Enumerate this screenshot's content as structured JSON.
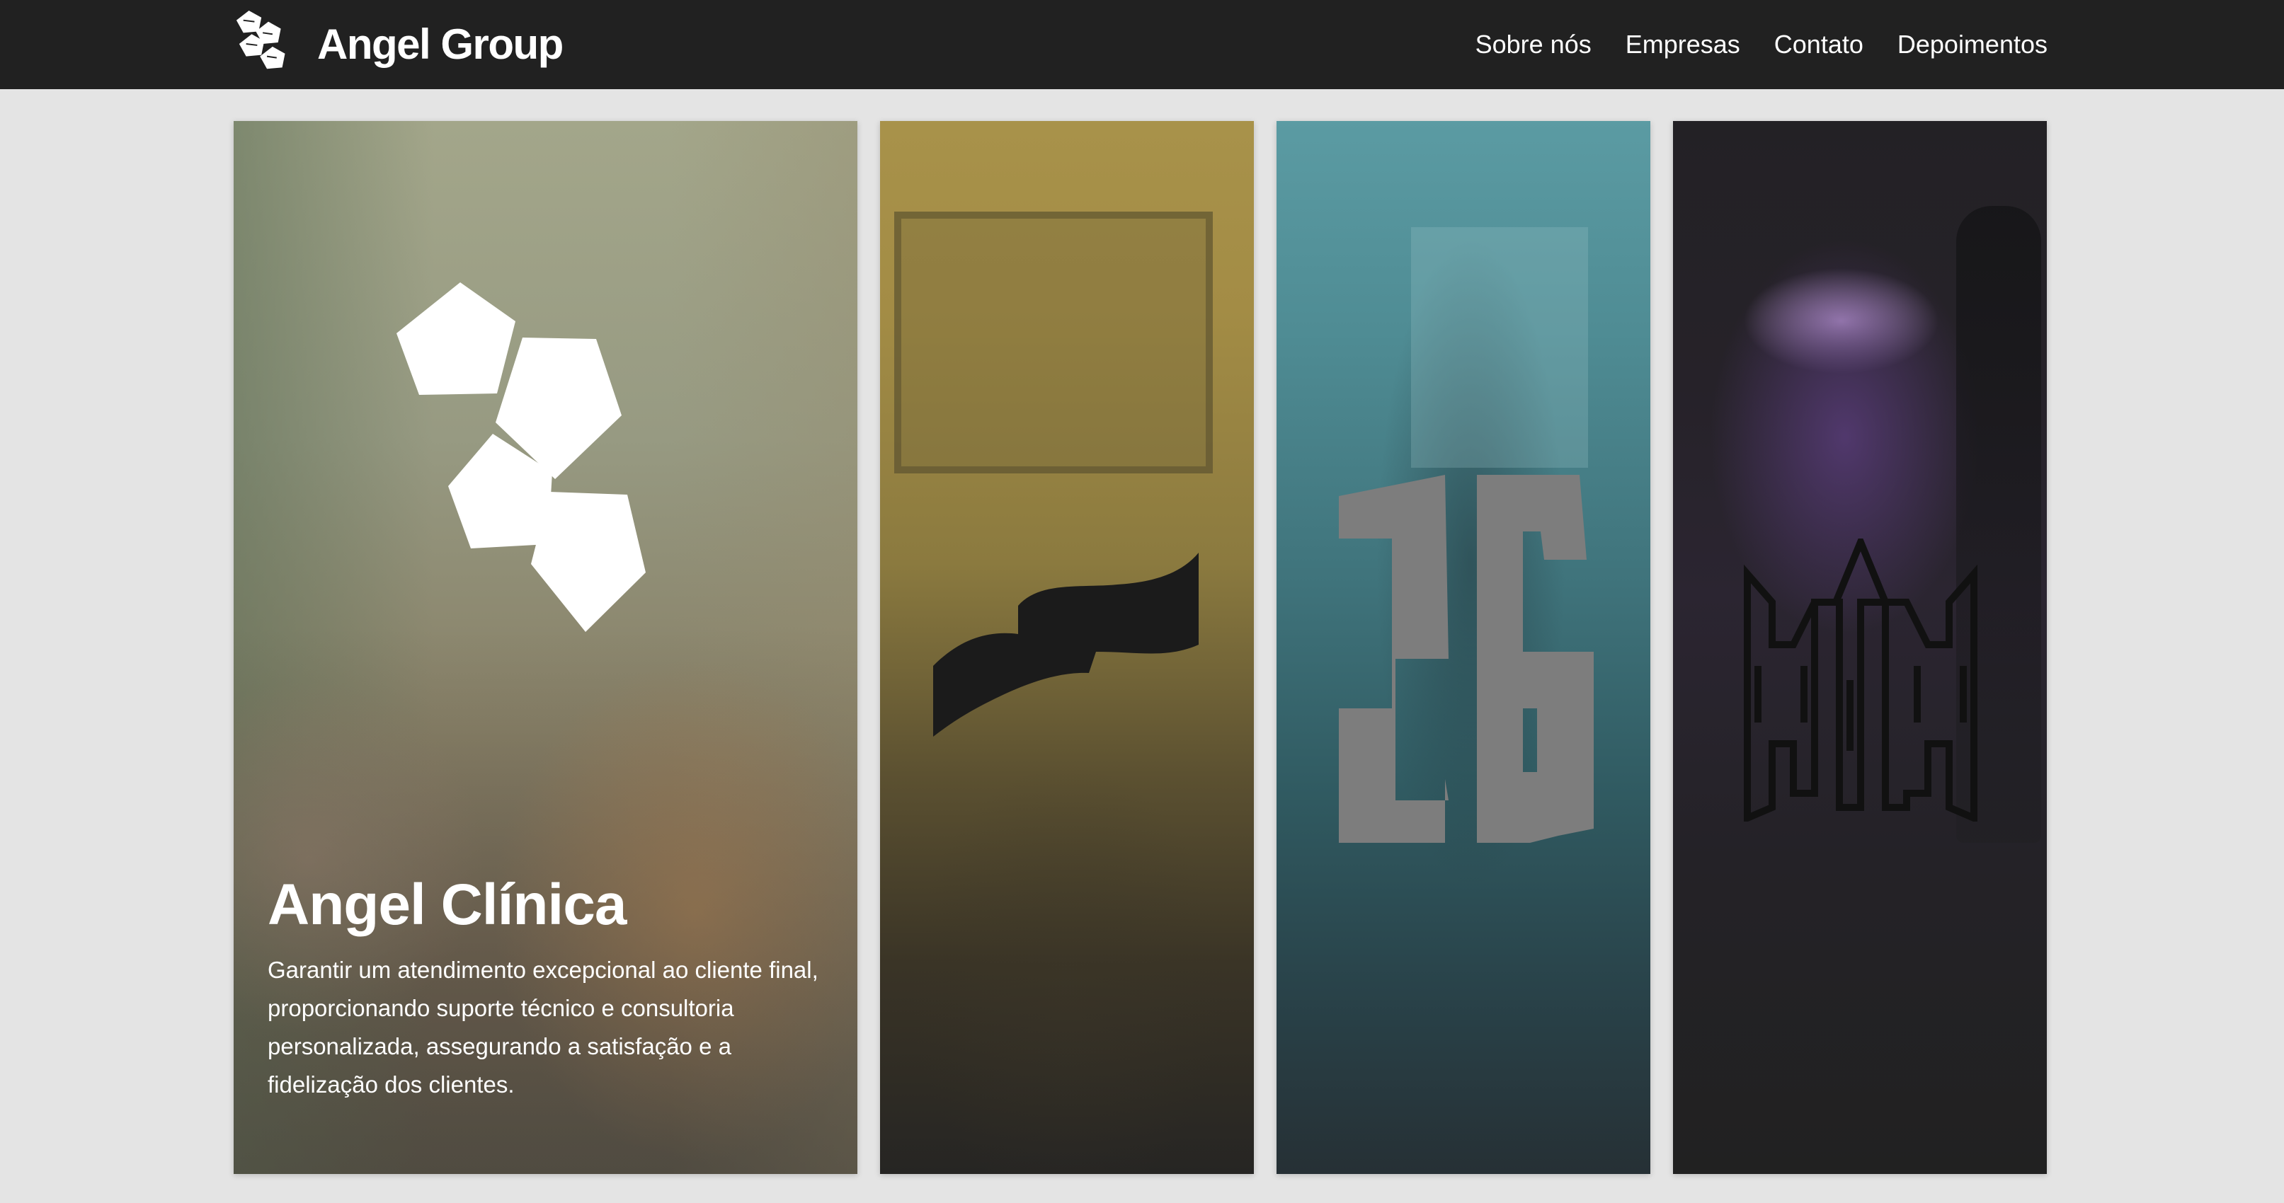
{
  "header": {
    "brand_name": "Angel Group",
    "nav": [
      "Sobre nós",
      "Empresas",
      "Contato",
      "Depoimentos"
    ]
  },
  "companies": [
    {
      "title": "Angel Clínica",
      "description": "Garantir um atendimento excepcional ao cliente final, proporcionando suporte técnico e consultoria personalizada, assegurando a satisfação e a fidelização dos clientes.",
      "logo_icon": "pentagon-cluster-logo",
      "overlay_color": "#8e8f74"
    },
    {
      "logo_icon": "flag-logo",
      "overlay_color": "#a38c45"
    },
    {
      "logo_icon": "sg-monogram-logo",
      "overlay_color": "#4f8c94"
    },
    {
      "logo_icon": "castle-outline-logo",
      "overlay_color": "#2b2531"
    }
  ],
  "colors": {
    "navbar_bg": "#212121",
    "page_bg": "#e4e4e4",
    "text": "#ffffff"
  }
}
